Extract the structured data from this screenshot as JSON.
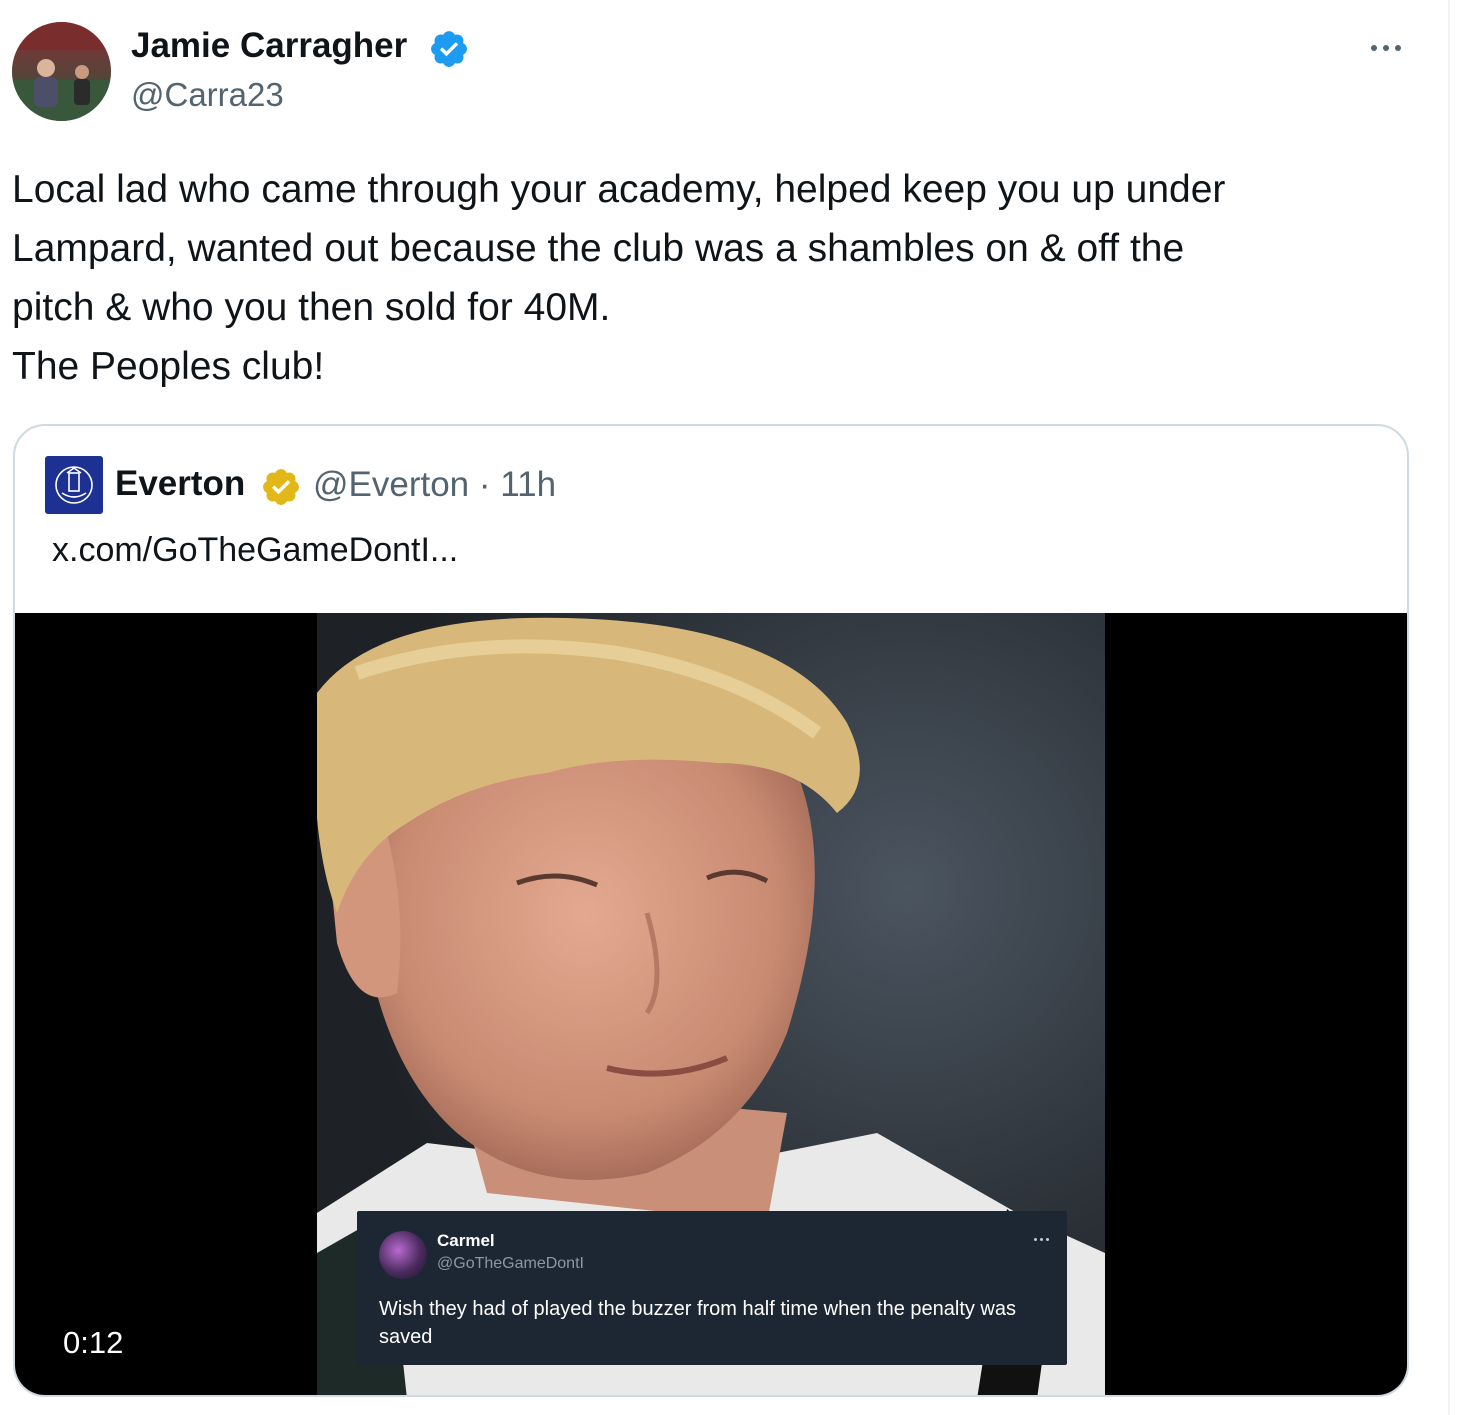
{
  "tweet": {
    "author": {
      "display_name": "Jamie Carragher",
      "handle": "@Carra23",
      "verified": true,
      "verified_color": "#1d9bf0"
    },
    "text_lines": [
      "Local lad who came through your academy, helped keep you up under",
      "Lampard, wanted out because the club was a shambles on & off the",
      "pitch & who you then sold for 40M.",
      "The Peoples club!"
    ],
    "more_icon": "ellipsis-icon"
  },
  "quote": {
    "author": {
      "display_name": "Everton",
      "handle": "@Everton",
      "time": "11h",
      "separator": "·",
      "verified": true,
      "verified_color": "#e2b719",
      "logo_color": "#1c3192"
    },
    "link_text": "x.com/GoTheGameDontI...",
    "video": {
      "duration": "0:12",
      "overlay_post": {
        "name": "Carmel",
        "handle": "@GoTheGameDontI",
        "text": "Wish they had of played the buzzer from half time when the penalty was saved"
      }
    }
  },
  "colors": {
    "text_primary": "#0f1419",
    "text_secondary": "#536471",
    "border": "#cfd9de"
  }
}
